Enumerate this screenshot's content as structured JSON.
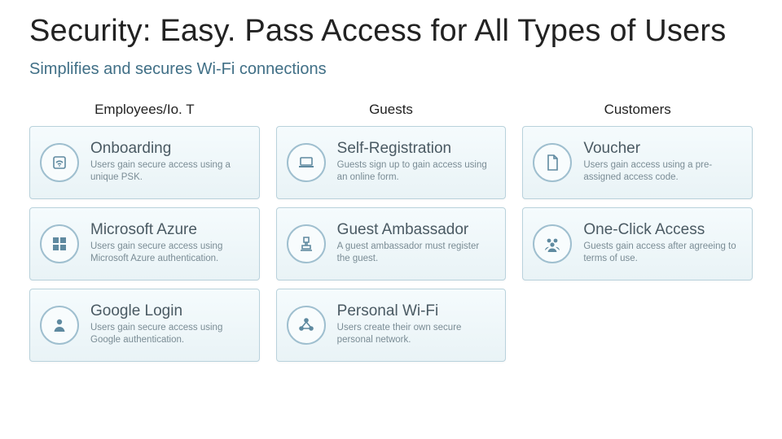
{
  "title": "Security: Easy. Pass Access for All Types of Users",
  "subtitle": "Simplifies and secures Wi-Fi connections",
  "columns": [
    {
      "label": "Employees/Io. T",
      "cards": [
        {
          "icon": "wifi-badge-icon",
          "title": "Onboarding",
          "desc": "Users gain secure access using a unique PSK."
        },
        {
          "icon": "azure-grid-icon",
          "title": "Microsoft Azure",
          "desc": "Users gain secure access using Microsoft Azure authentication."
        },
        {
          "icon": "person-icon",
          "title": "Google Login",
          "desc": "Users gain secure access using Google authentication."
        }
      ]
    },
    {
      "label": "Guests",
      "cards": [
        {
          "icon": "laptop-icon",
          "title": "Self-Registration",
          "desc": "Guests sign up to gain access using an online form."
        },
        {
          "icon": "stamp-icon",
          "title": "Guest Ambassador",
          "desc": "A guest ambassador must register the guest."
        },
        {
          "icon": "network-icon",
          "title": "Personal Wi-Fi",
          "desc": "Users create their own secure personal network."
        }
      ]
    },
    {
      "label": "Customers",
      "cards": [
        {
          "icon": "document-icon",
          "title": "Voucher",
          "desc": "Users gain access using a pre-assigned access code."
        },
        {
          "icon": "group-icon",
          "title": "One-Click Access",
          "desc": "Guests gain access after agreeing to terms of use."
        }
      ]
    }
  ],
  "icon_color": "#5f8aa0"
}
